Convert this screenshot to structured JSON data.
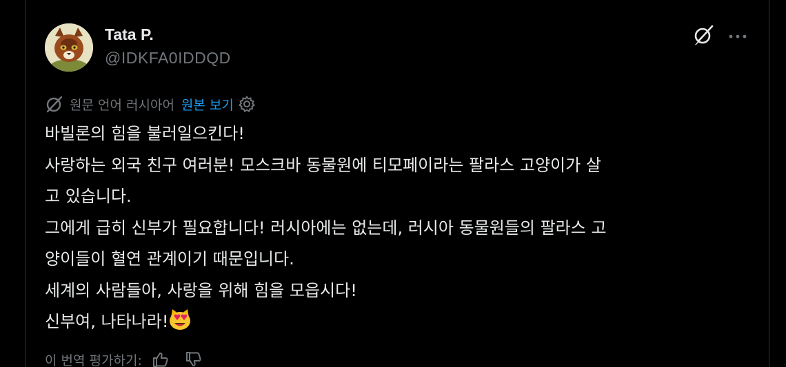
{
  "post": {
    "author": {
      "display_name": "Tata P.",
      "handle": "@IDKFA0IDDQD",
      "avatar": "cat-avatar"
    },
    "actions": {
      "grok_icon": "grok-icon",
      "more_icon": "more-options-icon"
    },
    "translation": {
      "source_language_label": "원문 언어 러시아어",
      "show_original_label": "원본 보기",
      "settings_icon": "gear-icon",
      "translate_icon": "translate-icon"
    },
    "body_lines": [
      "바빌론의 힘을 불러일으킨다!",
      "사랑하는 외국 친구 여러분! 모스크바 동물원에 티모페이라는 팔라스 고양이가 살",
      "고 있습니다.",
      "그에게 급히 신부가 필요합니다! 러시아에는 없는데, 러시아 동물원들의 팔라스 고",
      "양이들이 혈연 관계이기 때문입니다.",
      "세계의 사람들아, 사랑을 위해 힘을 모읍시다!",
      "신부여, 나타나라!"
    ],
    "emoji": "heart-eyes-cat",
    "rating": {
      "label": "이 번역 평가하기:",
      "thumbs_up_icon": "thumbs-up-icon",
      "thumbs_down_icon": "thumbs-down-icon"
    }
  },
  "colors": {
    "background": "#000000",
    "text_primary": "#e7e9ea",
    "text_secondary": "#71767b",
    "link": "#1d9bf0",
    "border": "#2f3336"
  }
}
